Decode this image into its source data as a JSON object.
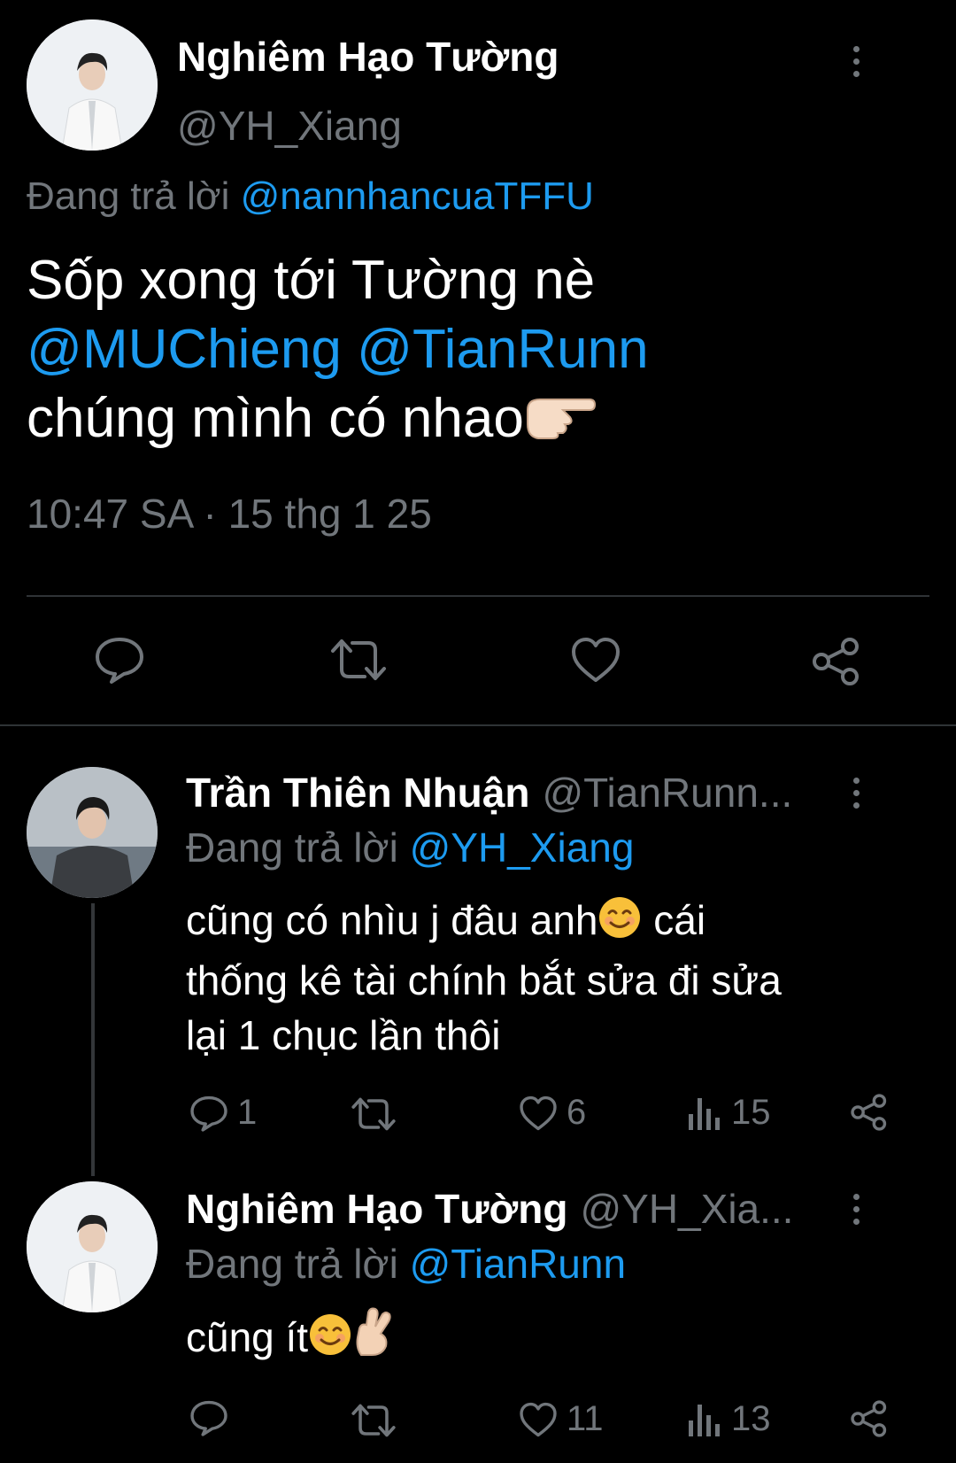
{
  "main_tweet": {
    "author_name": "Nghiêm Hạo Tường",
    "author_handle": "@YH_Xiang",
    "reply_prefix": "Đang trả lời",
    "reply_to": "@nannhancuaTFFU",
    "body_text_1": "Sốp xong tới Tường nè",
    "mention_1": "@MUChieng",
    "mention_2": "@TianRunn",
    "body_text_2": "chúng mình có nhao",
    "timestamp": "10:47 SA · 15 thg 1 25"
  },
  "reply_1": {
    "author_name": "Trần Thiên Nhuận",
    "author_handle": "@TianRunn...",
    "reply_prefix": "Đang trả lời",
    "reply_to": "@YH_Xiang",
    "line_1": "cũng có nhìu j đâu anh",
    "line_1b": "cái",
    "line_2": "thống kê tài chính bắt sửa đi sửa",
    "line_3": "lại 1 chục lần thôi",
    "reply_count": "1",
    "like_count": "6",
    "view_count": "15"
  },
  "reply_2": {
    "author_name": "Nghiêm Hạo Tường",
    "author_handle": "@YH_Xia...",
    "reply_prefix": "Đang trả lời",
    "reply_to": "@TianRunn",
    "body": "cũng ít",
    "like_count": "11",
    "view_count": "13"
  },
  "icons": {
    "reply": "reply-icon",
    "retweet": "retweet-icon",
    "like": "heart-icon",
    "share": "share-icon",
    "views": "views-icon",
    "more": "more-icon"
  },
  "colors": {
    "background": "#000000",
    "text": "#e7e9ea",
    "muted": "#71767b",
    "link": "#1d9bf0",
    "divider": "#2f3336"
  }
}
